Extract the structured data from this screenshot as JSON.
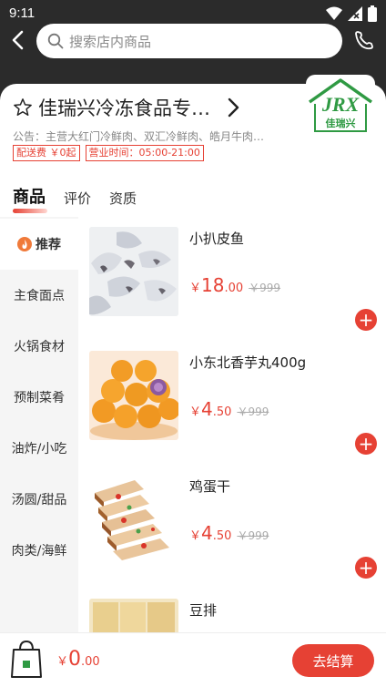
{
  "status_bar": {
    "time": "9:11"
  },
  "header": {
    "search_placeholder": "搜索店内商品"
  },
  "store": {
    "name": "佳瑞兴冷冻食品专…",
    "notice": "公告：主营大红门冷鲜肉、双汇冷鲜肉、皓月牛肉…",
    "tags": [
      "配送费 ￥0起",
      "营业时间：05:00-21:00"
    ],
    "logo_text": "JRX",
    "logo_subtitle": "佳瑞兴"
  },
  "tabs": [
    "商品",
    "评价",
    "资质"
  ],
  "categories": [
    "推荐",
    "主食面点",
    "火锅食材",
    "预制菜肴",
    "油炸/小吃",
    "汤圆/甜品",
    "肉类/海鲜"
  ],
  "products": [
    {
      "name": "小扒皮鱼",
      "currency": "￥",
      "price_int": "18",
      "price_dec": ".00",
      "orig_price": "￥999"
    },
    {
      "name": "小东北香芋丸400g",
      "currency": "￥",
      "price_int": "4",
      "price_dec": ".50",
      "orig_price": "￥999"
    },
    {
      "name": "鸡蛋干",
      "currency": "￥",
      "price_int": "4",
      "price_dec": ".50",
      "orig_price": "￥999"
    },
    {
      "name": "豆排"
    }
  ],
  "cart": {
    "currency": "￥",
    "total_int": "0",
    "total_dec": ".00",
    "checkout_label": "去结算"
  },
  "colors": {
    "accent": "#e64134",
    "header_bg": "#2b2b2b",
    "logo_green": "#2f9a43"
  }
}
